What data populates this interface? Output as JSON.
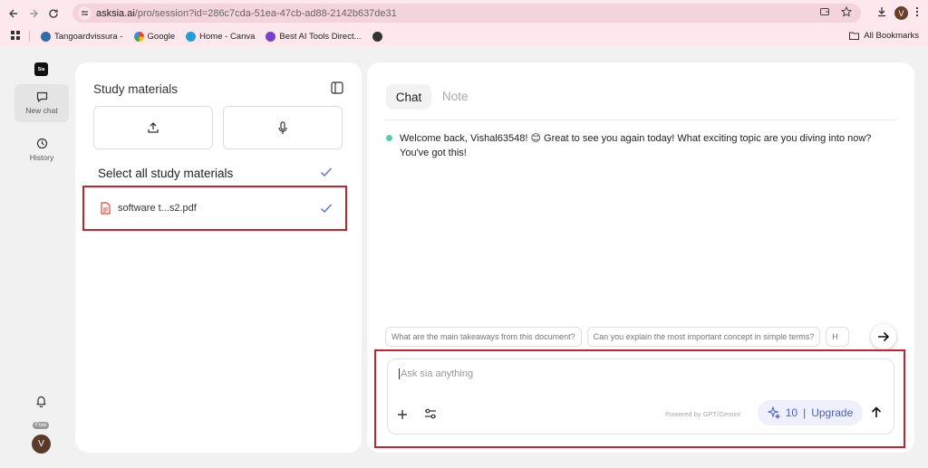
{
  "browser": {
    "url_host": "asksia.ai",
    "url_path": "/pro/session?id=286c7cda-51ea-47cb-ad88-2142b637de31",
    "profile_initial": "V",
    "bookmarks": [
      "Tangoardvissura -",
      "Google",
      "Home - Canva",
      "Best AI Tools Direct..."
    ],
    "all_bookmarks": "All Bookmarks"
  },
  "rail": {
    "logo_text": "Sia",
    "new_chat": "New chat",
    "history": "History",
    "plan_badge": "Free",
    "user_initial": "V"
  },
  "study": {
    "title": "Study materials",
    "select_all": "Select all study materials",
    "files": [
      "software t...s2.pdf"
    ]
  },
  "chat": {
    "tab_chat": "Chat",
    "tab_note": "Note",
    "welcome": "Welcome back, Vishal63548! 😊 Great to see you again today! What exciting topic are you diving into now? You've got this!",
    "suggestions": [
      "What are the main takeaways from this document?",
      "Can you explain the most important concept in simple terms?",
      "H"
    ],
    "input_placeholder": "Ask sia anything",
    "powered_by": "Powered by GPT/Gemini",
    "credits": "10",
    "upgrade_label": "Upgrade"
  },
  "colors": {
    "accent": "#5b6fd8",
    "highlight": "#c8232c",
    "online_dot": "#4fd1a3",
    "chrome_bg": "#fde8ee"
  }
}
